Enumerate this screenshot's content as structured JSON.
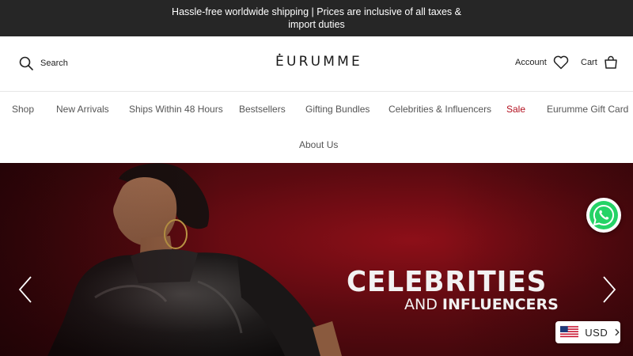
{
  "announcement": {
    "text": "Hassle-free worldwide shipping | Prices are inclusive of all taxes & import duties"
  },
  "header": {
    "search_label": "Search",
    "logo_text": "EURUMME",
    "account_label": "Account",
    "cart_label": "Cart"
  },
  "nav": {
    "items": [
      "Shop",
      "New Arrivals",
      "Ships Within 48 Hours",
      "Bestsellers",
      "Gifting Bundles",
      "Celebrities & Influencers",
      "Sale",
      "Eurumme Gift Card",
      "About Us"
    ]
  },
  "hero": {
    "title": "CELEBRITIES",
    "subtitle_prefix": "AND",
    "subtitle_emphasis": "INFLUENCERS"
  },
  "currency": {
    "code": "USD"
  },
  "colors": {
    "announcement_bg": "#262626",
    "sale": "#b3101f",
    "hero_bg": "#6e0c12",
    "whatsapp": "#25d366"
  },
  "icons": [
    "search-icon",
    "heart-icon",
    "cart-icon",
    "chevron-left-icon",
    "chevron-right-icon",
    "whatsapp-icon",
    "us-flag-icon",
    "chevron-right-small-icon"
  ]
}
